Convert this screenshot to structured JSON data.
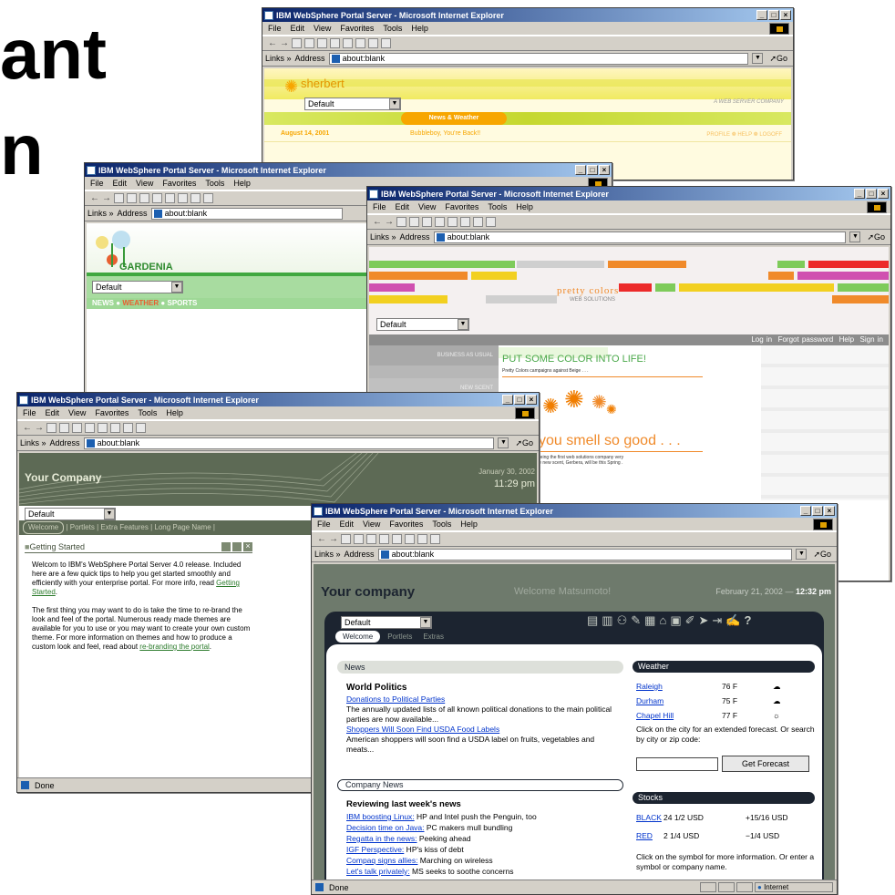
{
  "slide": {
    "line1": "ant",
    "line2": "n"
  },
  "window_title": "IBM WebSphere Portal Server - Microsoft Internet Explorer",
  "menu": [
    "File",
    "Edit",
    "View",
    "Favorites",
    "Tools",
    "Help"
  ],
  "links_label": "Links »",
  "address_label": "Address",
  "address_value": "about:blank",
  "go_label": "Go",
  "status_done": "Done",
  "status_zone": "Internet",
  "sherbert": {
    "brand": "sherbert",
    "tagline": "A WEB SERVER COMPANY",
    "select": "Default",
    "tab": "News & Weather",
    "date": "August 14, 2001",
    "greeting": "Bubbleboy, You're Back!!",
    "links": "PROFILE  ❁  HELP  ❁  LOGOFF"
  },
  "gardenia": {
    "brand": "GARDENIA",
    "select": "Default",
    "nav": [
      "NEWS",
      "WEATHER",
      "SPORTS"
    ]
  },
  "pretty": {
    "brand": "pretty colors",
    "sub": "WEB SOLUTIONS",
    "select": "Default",
    "nav": [
      "Log in",
      "Forgot password",
      "Help",
      "Sign in"
    ],
    "side1": "BUSINESS AS USUAL",
    "side2": "NEW SCENT",
    "headline": "PUT SOME COLOR INTO LIFE!",
    "headline_sub": "Pretty Colors campaigns against Beige . . .",
    "smell": "you smell so good . . .",
    "smell_sub": "makes history by being the first web solutions company very own fragrance. The new scent, Gerbera, will be this Spring . . ."
  },
  "yourco1": {
    "brand": "Your Company",
    "date": "January 30, 2002",
    "time": "11:29 pm",
    "select": "Default",
    "tabs": [
      "Welcome",
      "Portlets",
      "Extra Features",
      "Long Page Name"
    ],
    "portlet_title": "Getting Started",
    "p1_before": "Welcom to IBM's WebSphere Portal Server 4.0 release. Included here are a few quick tips to help you get started smoothly and efficiently with your enterprise portal. For more info, read ",
    "p1_link": "Getting Started",
    "p1_after": ".",
    "p2_before": "The first thing you may want to do is take the time to re-brand the look and feel of the portal. Numerous ready made themes are available for you to use or you may want to create your own custom theme. For more information on themes and how to produce a custom look and feel, read about ",
    "p2_link": "re-branding the portal",
    "p2_after": "."
  },
  "yourco2": {
    "brand": "Your company",
    "welcome": "Welcome Matsumoto!",
    "date": "February 21, 2002 —",
    "time": "12:32 pm",
    "select": "Default",
    "tabs": [
      "Welcome",
      "Portlets",
      "Extras"
    ],
    "news_title": "News",
    "world_title": "World Politics",
    "n1_link": "Donations to Political Parties",
    "n1_text": "The annually updated lists of all known political donations to the main political parties are now available...",
    "n2_link": "Shoppers Will Soon Find USDA Food Labels",
    "n2_text": "American shoppers will soon find a USDA label on fruits, vegetables and meats...",
    "company_title": "Company News",
    "review_title": "Reviewing last week's news",
    "company_items": [
      {
        "link": "IBM boosting Linux:",
        "text": " HP and Intel push the Penguin, too"
      },
      {
        "link": "Decision time on Java:",
        "text": " PC makers mull bundling"
      },
      {
        "link": "Regatta in the news:",
        "text": " Peeking ahead"
      },
      {
        "link": "IGF Perspective:",
        "text": " HP's kiss of debt"
      },
      {
        "link": "Compaq signs allies:",
        "text": " Marching on wireless"
      },
      {
        "link": "Let's talk privately:",
        "text": " MS seeks to soothe concerns"
      }
    ],
    "weather_title": "Weather",
    "weather": [
      {
        "city": "Raleigh",
        "temp": "76 F",
        "icon": "cloud-icon"
      },
      {
        "city": "Durham",
        "temp": "75 F",
        "icon": "cloud-icon"
      },
      {
        "city": "Chapel Hill",
        "temp": "77 F",
        "icon": "sun-icon"
      }
    ],
    "weather_note": "Click on the city for an extended forecast. Or search by city or zip code:",
    "forecast_btn": "Get Forecast",
    "stocks_title": "Stocks",
    "stocks": [
      {
        "sym": "BLACK",
        "price": "24 1/2 USD",
        "chg": "+15/16 USD"
      },
      {
        "sym": "RED",
        "price": "2 1/4 USD",
        "chg": "−1/4 USD"
      }
    ],
    "stocks_note": "Click on the symbol for more information. Or enter a symbol or company name."
  }
}
